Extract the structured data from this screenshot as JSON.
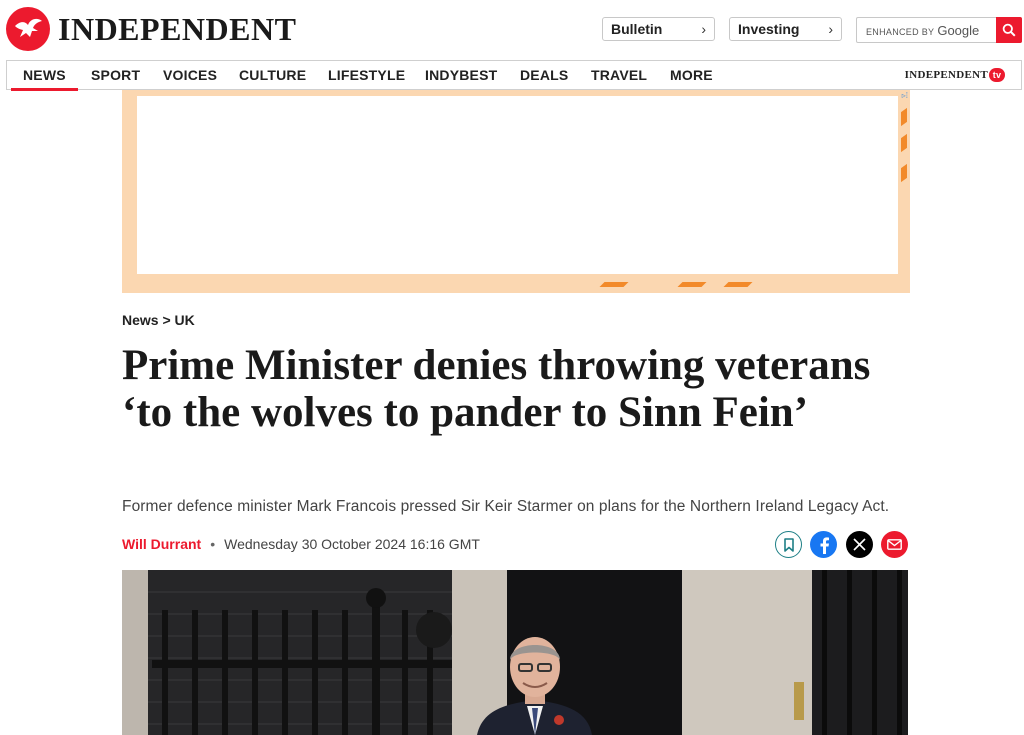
{
  "header": {
    "logo_text": "INDEPENDENT",
    "bulletin_label": "Bulletin",
    "investing_label": "Investing",
    "search": {
      "enhanced_by": "ENHANCED BY",
      "provider": "Google"
    }
  },
  "nav": {
    "items": [
      {
        "label": "NEWS"
      },
      {
        "label": "SPORT"
      },
      {
        "label": "VOICES"
      },
      {
        "label": "CULTURE"
      },
      {
        "label": "LIFESTYLE"
      },
      {
        "label": "INDYBEST"
      },
      {
        "label": "DEALS"
      },
      {
        "label": "TRAVEL"
      },
      {
        "label": "MORE"
      }
    ],
    "active": "NEWS",
    "tv_brand": "INDEPENDENT",
    "tv_badge": "tv"
  },
  "article": {
    "breadcrumb": "News > UK",
    "headline": "Prime Minister denies throwing veterans ‘to the wolves to pander to Sinn Fein’",
    "standfirst": "Former defence minister Mark Francois pressed Sir Keir Starmer on plans for the Northern Ireland Legacy Act.",
    "author": "Will Durrant",
    "separator": "•",
    "date": "Wednesday 30 October 2024 16:16 GMT"
  },
  "share": {
    "icons": [
      "bookmark-icon",
      "facebook-icon",
      "x-icon",
      "email-icon"
    ]
  },
  "colors": {
    "brand_red": "#ec1a2e",
    "ad_border": "#fbd7b1",
    "ad_stripe": "#f28a2a",
    "bookmark_teal": "#1d7f86",
    "facebook_blue": "#1877f2"
  }
}
